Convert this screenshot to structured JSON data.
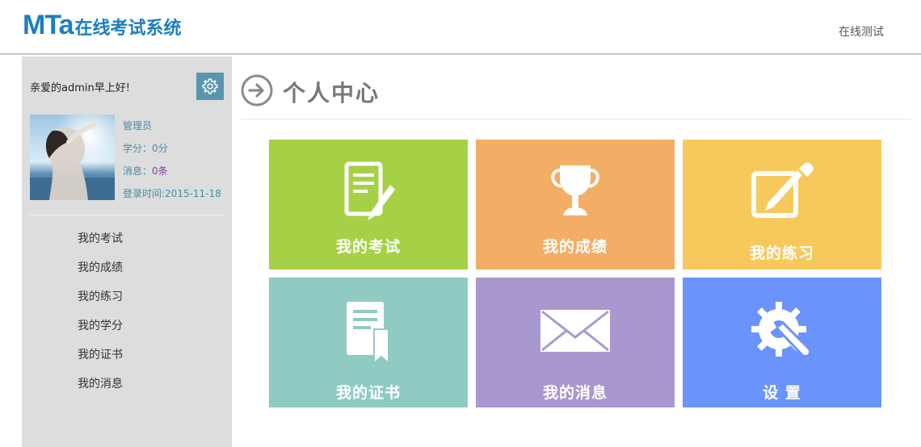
{
  "header": {
    "logo_mark": "MTa",
    "logo_text": "在线考试系统",
    "nav_link": "在线测试",
    "brand_color": "#1b7ec2"
  },
  "sidebar": {
    "greeting": "亲爱的admin早上好!",
    "settings_icon": "gear-icon",
    "role": "管理员",
    "score_label": "学分：",
    "score_value": "0分",
    "messages_label": "消息：",
    "messages_value": "0条",
    "login_label": "登录时间:",
    "login_value": "2015-11-18",
    "menu": [
      {
        "label": "我的考试"
      },
      {
        "label": "我的成绩"
      },
      {
        "label": "我的练习"
      },
      {
        "label": "我的学分"
      },
      {
        "label": "我的证书"
      },
      {
        "label": "我的消息"
      }
    ]
  },
  "main": {
    "title_icon": "arrow-right-circle-icon",
    "title": "个人中心",
    "tiles": [
      {
        "label": "我的考试",
        "icon": "exam-edit-icon",
        "color": "#a6d146"
      },
      {
        "label": "我的成绩",
        "icon": "trophy-icon",
        "color": "#f3ad64"
      },
      {
        "label": "我的练习",
        "icon": "pencil-square-icon",
        "color": "#f7c95c"
      },
      {
        "label": "我的证书",
        "icon": "certificate-icon",
        "color": "#90cbc3"
      },
      {
        "label": "我的消息",
        "icon": "envelope-icon",
        "color": "#a997d0"
      },
      {
        "label": "设 置",
        "icon": "settings-wrench-icon",
        "color": "#6a94fb"
      }
    ]
  }
}
